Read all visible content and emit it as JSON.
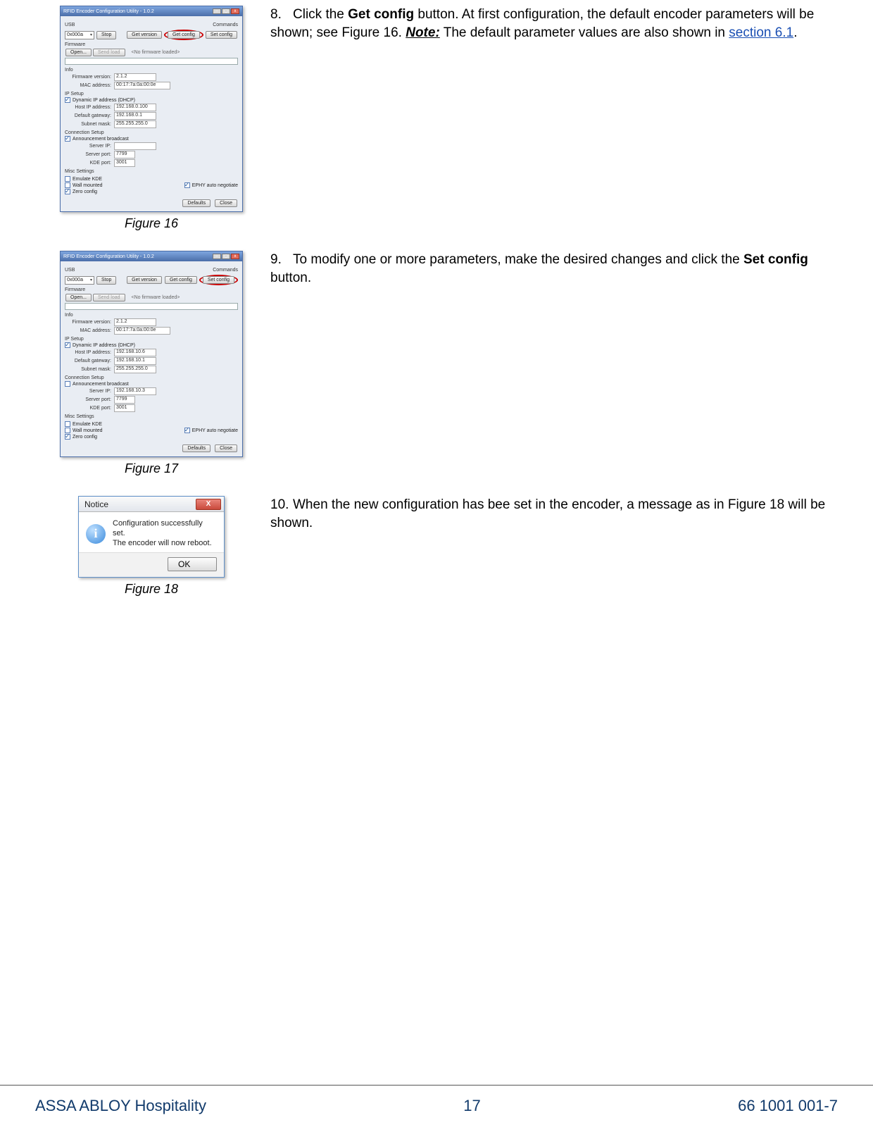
{
  "configWin": {
    "title": "RFID Encoder Configuration Utility - 1.0.2",
    "usbLabel": "USB",
    "commandsLabel": "Commands",
    "comValue": "0x000a",
    "stopBtn": "Stop",
    "getVersion": "Get version",
    "getConfig": "Get config",
    "setConfig": "Set config",
    "firmwareLabel": "Firmware",
    "openBtn": "Open...",
    "sendLoadBtn": "Send load",
    "noFirmware": "<No firmware loaded>",
    "infoLabel": "Info",
    "fwVersionLabel": "Firmware version:",
    "macLabel": "MAC address:",
    "ipSetupLabel": "IP Setup",
    "dhcpLabel": "Dynamic IP address (DHCP)",
    "hostIpLabel": "Host IP address:",
    "gatewayLabel": "Default gateway:",
    "subnetLabel": "Subnet mask:",
    "connLabel": "Connection Setup",
    "announceLabel": "Announcement broadcast",
    "serverIpLabel": "Server IP:",
    "serverPortLabel": "Server port:",
    "kdePortLabel": "KDE port:",
    "miscLabel": "Misc Settings",
    "emulateLabel": "Emulate KDE",
    "wallLabel": "Wall mounted",
    "zeroLabel": "Zero config",
    "ephyLabel": "EPHY auto negotiate",
    "defaultsBtn": "Defaults",
    "closeBtn": "Close"
  },
  "fig16": {
    "caption": "Figure 16",
    "fwVersion": "2.1.2",
    "mac": "00:17:7a:0a:00:0e",
    "hostIp": "192.168.0.100",
    "gateway": "192.168.0.1",
    "subnet": "255.255.255.0",
    "serverIp": "",
    "serverPort": "7799",
    "kdePort": "3001"
  },
  "fig17": {
    "caption": "Figure 17",
    "fwVersion": "2.1.2",
    "mac": "00:17:7a:0a:00:0e",
    "hostIp": "192.168.10.6",
    "gateway": "192.168.10.1",
    "subnet": "255.255.255.0",
    "serverIp": "192.168.10.3",
    "serverPort": "7799",
    "kdePort": "3001"
  },
  "fig18": {
    "caption": "Figure 18",
    "title": "Notice",
    "line1": "Configuration successfully set.",
    "line2": "The encoder will now reboot.",
    "ok": "OK"
  },
  "step8": {
    "num": "8.",
    "pre": "Click the ",
    "btn": "Get config",
    "post1": " button. At first configuration, the default encoder parameters will be shown; see Figure 16. ",
    "note": "Note:",
    "post2": " The default parameter values are also shown in ",
    "linkText": "section 6.1",
    "post3": "."
  },
  "step9": {
    "num": "9.",
    "pre": "To modify one or more parameters, make the desired changes and click the ",
    "btn": "Set config",
    "post": " button."
  },
  "step10": {
    "num": "10.",
    "text": "When the new configuration has bee set in the encoder, a message as in Figure 18 will be shown."
  },
  "footer": {
    "company": "ASSA ABLOY Hospitality",
    "page": "17",
    "doc": "66 1001 001-7"
  }
}
